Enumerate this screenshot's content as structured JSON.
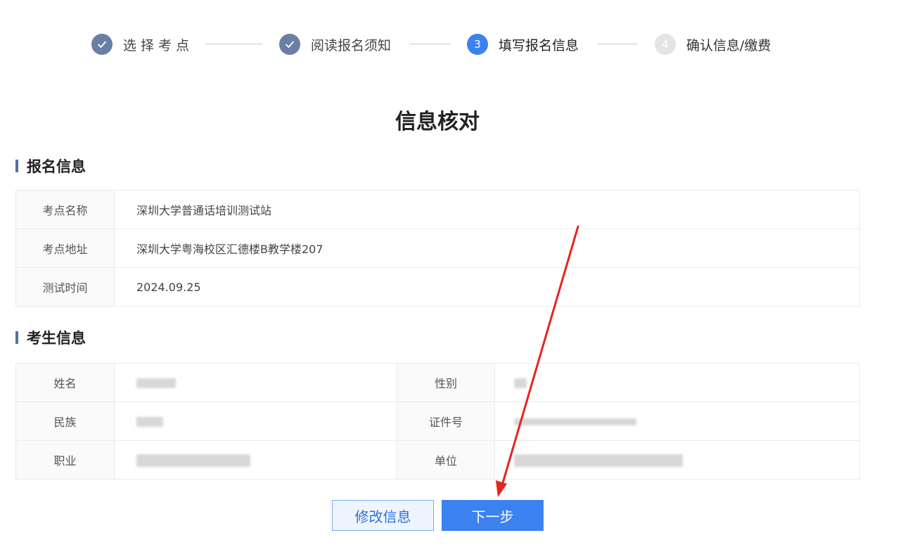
{
  "steps": [
    {
      "label": "选 择 考 点",
      "status": "done",
      "icon": "check-icon"
    },
    {
      "label": "阅读报名须知",
      "status": "done",
      "icon": "check-icon"
    },
    {
      "label": "填写报名信息",
      "status": "active",
      "number": "3"
    },
    {
      "label": "确认信息/缴费",
      "status": "todo",
      "number": "4"
    }
  ],
  "page_title": "信息核对",
  "registration": {
    "heading": "报名信息",
    "rows": [
      {
        "label": "考点名称",
        "value": "深圳大学普通话培训测试站"
      },
      {
        "label": "考点地址",
        "value": "深圳大学粤海校区汇德楼B教学楼207"
      },
      {
        "label": "测试时间",
        "value": "2024.09.25"
      }
    ]
  },
  "candidate": {
    "heading": "考生信息",
    "labels": {
      "name": "姓名",
      "gender": "性别",
      "ethnicity": "民族",
      "id_number": "证件号",
      "occupation": "职业",
      "employer": "单位"
    }
  },
  "buttons": {
    "edit": "修改信息",
    "next": "下一步"
  },
  "colors": {
    "primary": "#3b82f0",
    "step_done": "#6a7fa6",
    "annotation_arrow": "#e8231f"
  }
}
